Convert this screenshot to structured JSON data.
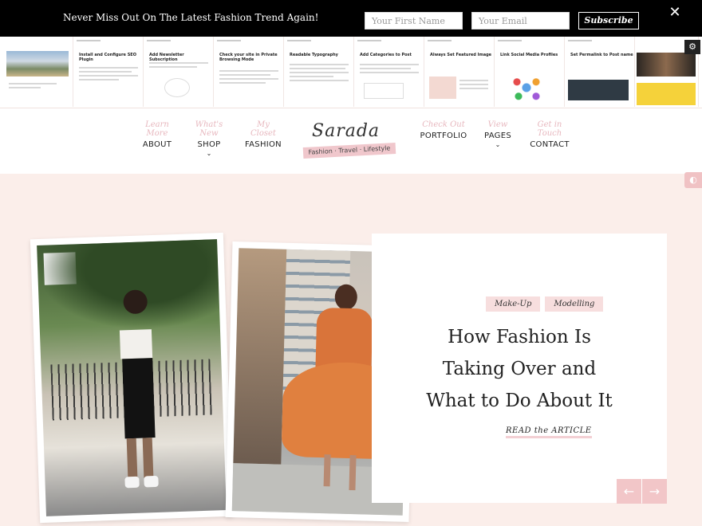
{
  "topbar": {
    "message": "Never Miss Out On The Latest Fashion Trend Again!",
    "first_name_placeholder": "Your First Name",
    "email_placeholder": "Your Email",
    "subscribe_label": "Subscribe",
    "close_glyph": "✕"
  },
  "posts_strip": [
    {
      "title": "",
      "icon": "mountain-photo"
    },
    {
      "title": "Install and Configure SEO Plugin",
      "icon": "text"
    },
    {
      "title": "Add Newsletter Subscription",
      "icon": "illustration"
    },
    {
      "title": "Check your site in Private Browsing Mode",
      "icon": "text"
    },
    {
      "title": "Readable Typography",
      "icon": "text"
    },
    {
      "title": "Add Categories to Post",
      "icon": "text"
    },
    {
      "title": "Always Set Featured Image",
      "icon": "chart"
    },
    {
      "title": "Link Social Media Profiles",
      "icon": "social"
    },
    {
      "title": "Set Permalink to Post name",
      "icon": "dashboard"
    },
    {
      "title": "",
      "icon": "photo"
    }
  ],
  "nav": {
    "items_left": [
      {
        "script": "Learn More",
        "label": "ABOUT",
        "dropdown": false
      },
      {
        "script": "What's New",
        "label": "SHOP",
        "dropdown": true
      },
      {
        "script": "My Closet",
        "label": "FASHION",
        "dropdown": false
      }
    ],
    "items_right": [
      {
        "script": "Check Out",
        "label": "PORTFOLIO",
        "dropdown": false
      },
      {
        "script": "View",
        "label": "PAGES",
        "dropdown": true
      },
      {
        "script": "Get in Touch",
        "label": "CONTACT",
        "dropdown": false
      }
    ],
    "logo_name": "Sarada",
    "logo_tagline": "Fashion · Travel · Lifestyle"
  },
  "hero": {
    "tags": [
      "Make-Up",
      "Modelling"
    ],
    "headline_lines": [
      "How Fashion Is",
      "Taking Over and",
      "What to Do About It"
    ],
    "read_more": "READ the ARTICLE",
    "prev_glyph": "←",
    "next_glyph": "→"
  },
  "colors": {
    "accent_pink": "#f2c6c8",
    "script_pink": "#e7b7be",
    "page_bg": "#fbeeea",
    "topbar_bg": "#000000"
  }
}
